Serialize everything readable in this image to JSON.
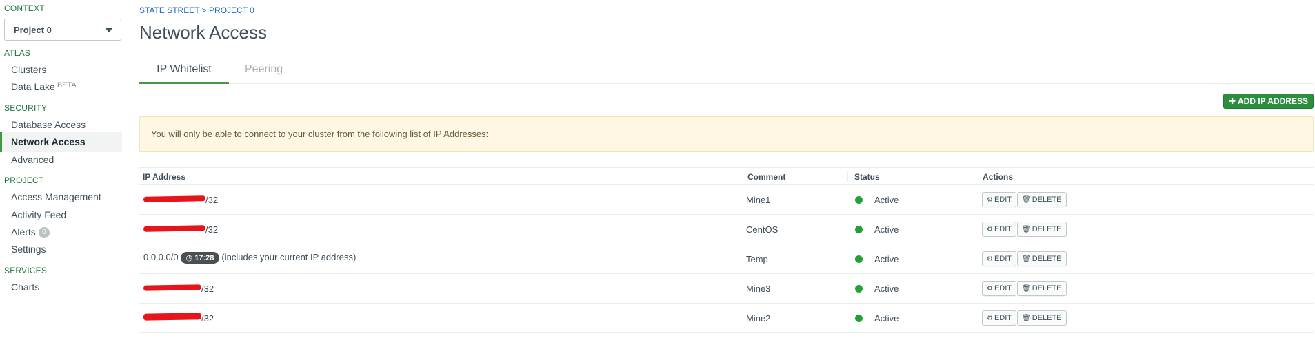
{
  "sidebar": {
    "context_label": "CONTEXT",
    "context_value": "Project 0",
    "sections": [
      {
        "title": "ATLAS",
        "items": [
          {
            "label": "Clusters"
          },
          {
            "label": "Data Lake",
            "badge": "BETA"
          }
        ]
      },
      {
        "title": "SECURITY",
        "items": [
          {
            "label": "Database Access"
          },
          {
            "label": "Network Access",
            "active": true
          },
          {
            "label": "Advanced"
          }
        ]
      },
      {
        "title": "PROJECT",
        "items": [
          {
            "label": "Access Management"
          },
          {
            "label": "Activity Feed"
          },
          {
            "label": "Alerts",
            "count": "0"
          },
          {
            "label": "Settings"
          }
        ]
      },
      {
        "title": "SERVICES",
        "items": [
          {
            "label": "Charts"
          }
        ]
      }
    ]
  },
  "main": {
    "breadcrumb": "STATE STREET > PROJECT 0",
    "title": "Network Access",
    "tabs": [
      {
        "label": "IP Whitelist",
        "active": true
      },
      {
        "label": "Peering"
      }
    ],
    "add_button": "ADD IP ADDRESS",
    "notice": "You will only be able to connect to your cluster from the following list of IP Addresses:",
    "table": {
      "headers": [
        "IP Address",
        "Comment",
        "Status",
        "Actions"
      ],
      "rows": [
        {
          "ip_suffix": "/32",
          "redacted": true,
          "comment": "Mine1",
          "status": "Active"
        },
        {
          "ip_suffix": "/32",
          "redacted": true,
          "comment": "CentOS",
          "status": "Active"
        },
        {
          "ip": "0.0.0.0/0",
          "timer": "17:28",
          "note": "(includes your current IP address)",
          "redacted": false,
          "comment": "Temp",
          "status": "Active"
        },
        {
          "ip_suffix": "/32",
          "redacted": true,
          "comment": "Mine3",
          "status": "Active"
        },
        {
          "ip_suffix": "/32",
          "redacted": true,
          "comment": "Mine2",
          "status": "Active"
        }
      ],
      "edit_label": "EDIT",
      "delete_label": "DELETE"
    }
  },
  "colors": {
    "accent_green": "#3f9945",
    "button_green": "#2c8f3e",
    "status_active": "#21a235",
    "link_blue": "#1b6ac9",
    "redaction": "#e8141b",
    "notice_bg": "#fef7e3"
  },
  "icons": {
    "select_caret": "caret-down-icon",
    "add": "plus-icon",
    "timer": "clock-icon",
    "edit": "gear-icon",
    "delete": "trash-icon",
    "status": "status-dot-icon"
  }
}
